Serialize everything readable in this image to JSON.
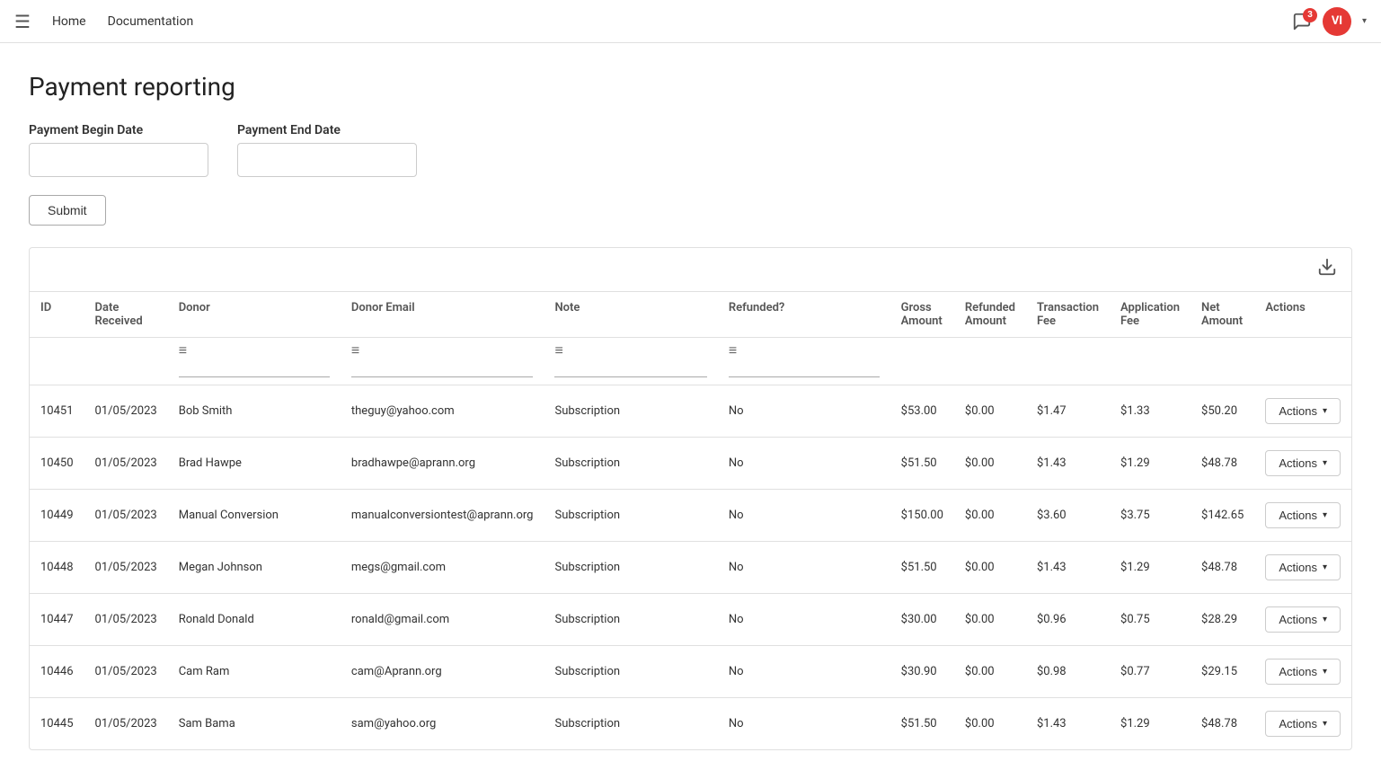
{
  "nav": {
    "hamburger_icon": "☰",
    "home_label": "Home",
    "docs_label": "Documentation",
    "notification_count": "3",
    "avatar_initials": "VI"
  },
  "page": {
    "title": "Payment reporting",
    "begin_date_label": "Payment Begin Date",
    "end_date_label": "Payment End Date",
    "begin_date_placeholder": "",
    "end_date_placeholder": "",
    "submit_label": "Submit"
  },
  "table": {
    "download_icon": "⬇",
    "columns": [
      "ID",
      "Date Received",
      "Donor",
      "Donor Email",
      "Note",
      "Refunded?",
      "Gross Amount",
      "Refunded Amount",
      "Transaction Fee",
      "Application Fee",
      "Net Amount",
      "Actions"
    ],
    "rows": [
      {
        "id": "10451",
        "date": "01/05/2023",
        "donor": "Bob Smith",
        "email": "theguy@yahoo.com",
        "note": "Subscription",
        "refunded": "No",
        "gross": "$53.00",
        "refunded_amt": "$0.00",
        "transaction_fee": "$1.47",
        "app_fee": "$1.33",
        "net": "$50.20"
      },
      {
        "id": "10450",
        "date": "01/05/2023",
        "donor": "Brad Hawpe",
        "email": "bradhawpe@aprann.org",
        "note": "Subscription",
        "refunded": "No",
        "gross": "$51.50",
        "refunded_amt": "$0.00",
        "transaction_fee": "$1.43",
        "app_fee": "$1.29",
        "net": "$48.78"
      },
      {
        "id": "10449",
        "date": "01/05/2023",
        "donor": "Manual Conversion",
        "email": "manualconversiontest@aprann.org",
        "note": "Subscription",
        "refunded": "No",
        "gross": "$150.00",
        "refunded_amt": "$0.00",
        "transaction_fee": "$3.60",
        "app_fee": "$3.75",
        "net": "$142.65"
      },
      {
        "id": "10448",
        "date": "01/05/2023",
        "donor": "Megan Johnson",
        "email": "megs@gmail.com",
        "note": "Subscription",
        "refunded": "No",
        "gross": "$51.50",
        "refunded_amt": "$0.00",
        "transaction_fee": "$1.43",
        "app_fee": "$1.29",
        "net": "$48.78"
      },
      {
        "id": "10447",
        "date": "01/05/2023",
        "donor": "Ronald Donald",
        "email": "ronald@gmail.com",
        "note": "Subscription",
        "refunded": "No",
        "gross": "$30.00",
        "refunded_amt": "$0.00",
        "transaction_fee": "$0.96",
        "app_fee": "$0.75",
        "net": "$28.29"
      },
      {
        "id": "10446",
        "date": "01/05/2023",
        "donor": "Cam Ram",
        "email": "cam@Aprann.org",
        "note": "Subscription",
        "refunded": "No",
        "gross": "$30.90",
        "refunded_amt": "$0.00",
        "transaction_fee": "$0.98",
        "app_fee": "$0.77",
        "net": "$29.15"
      },
      {
        "id": "10445",
        "date": "01/05/2023",
        "donor": "Sam Bama",
        "email": "sam@yahoo.org",
        "note": "Subscription",
        "refunded": "No",
        "gross": "$51.50",
        "refunded_amt": "$0.00",
        "transaction_fee": "$1.43",
        "app_fee": "$1.29",
        "net": "$48.78"
      }
    ],
    "actions_label": "Actions",
    "actions_caret": "▾"
  }
}
